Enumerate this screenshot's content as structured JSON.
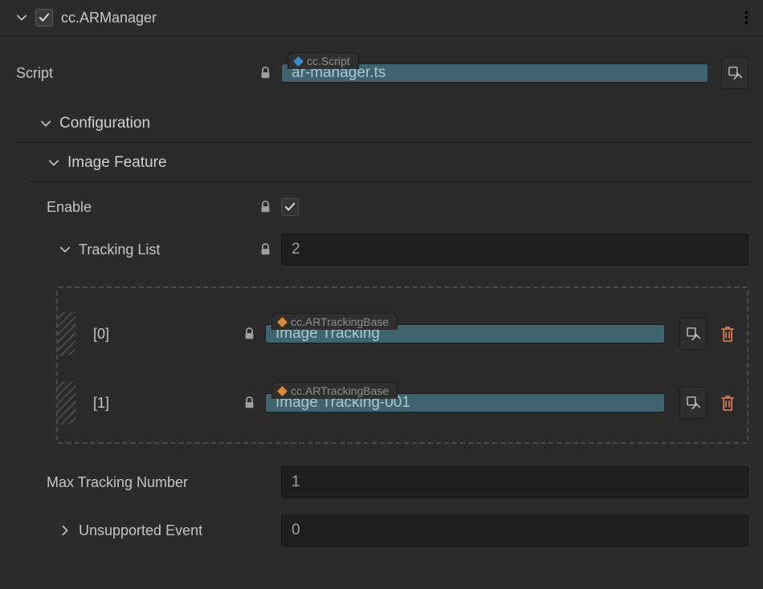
{
  "header": {
    "title": "cc.ARManager"
  },
  "script": {
    "label": "Script",
    "type_badge": "cc.Script",
    "value": "ar-manager.ts"
  },
  "configuration": {
    "label": "Configuration"
  },
  "image_feature": {
    "label": "Image Feature",
    "enable": {
      "label": "Enable",
      "checked": true
    },
    "tracking_list": {
      "label": "Tracking List",
      "count": "2",
      "items": [
        {
          "index_label": "[0]",
          "type_badge": "cc.ARTrackingBase",
          "value": "Image Tracking"
        },
        {
          "index_label": "[1]",
          "type_badge": "cc.ARTrackingBase",
          "value": "Image Tracking-001"
        }
      ]
    },
    "max_tracking_number": {
      "label": "Max Tracking Number",
      "value": "1"
    },
    "unsupported_event": {
      "label": "Unsupported Event",
      "value": "0"
    }
  }
}
